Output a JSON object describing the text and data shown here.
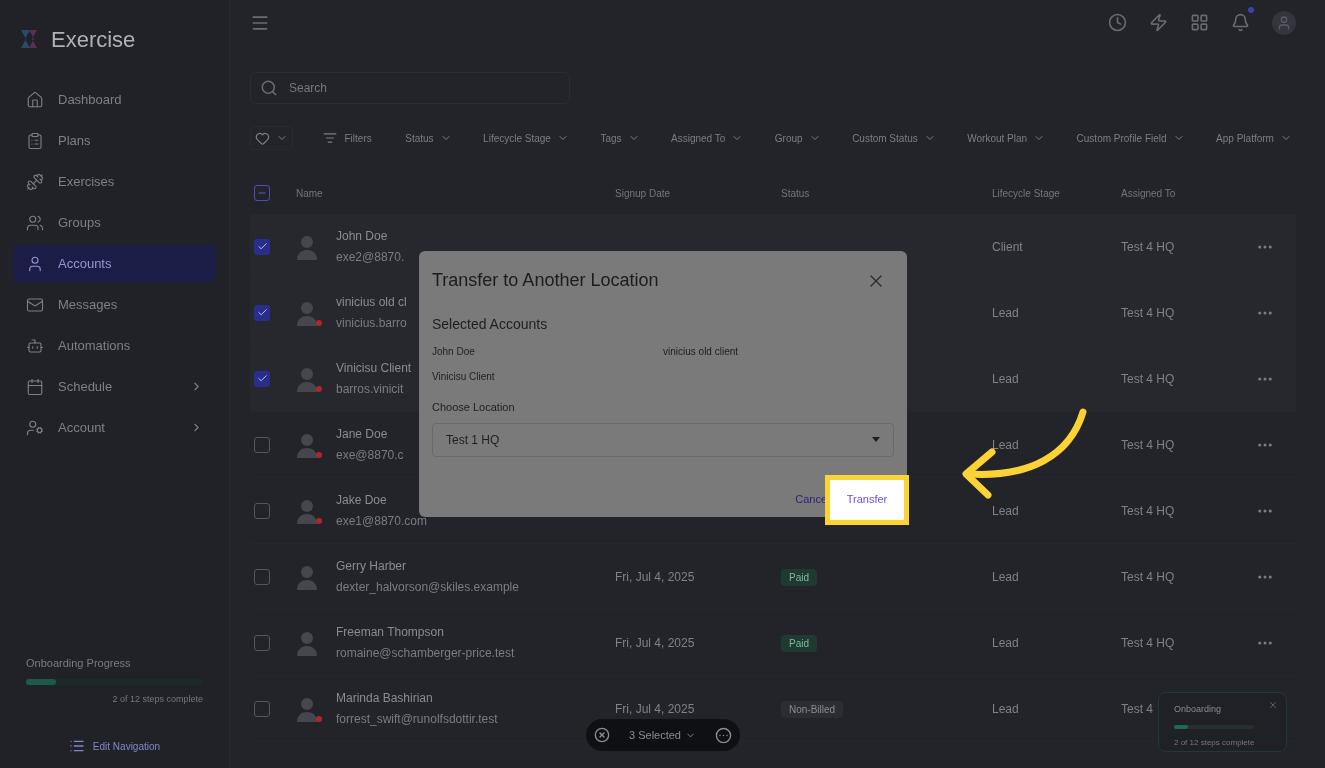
{
  "app": {
    "name": "Exercise"
  },
  "sidebar": {
    "items": [
      {
        "label": "Dashboard",
        "selected": false,
        "expandable": false
      },
      {
        "label": "Plans",
        "selected": false,
        "expandable": false
      },
      {
        "label": "Exercises",
        "selected": false,
        "expandable": false
      },
      {
        "label": "Groups",
        "selected": false,
        "expandable": false
      },
      {
        "label": "Accounts",
        "selected": true,
        "expandable": false
      },
      {
        "label": "Messages",
        "selected": false,
        "expandable": false
      },
      {
        "label": "Automations",
        "selected": false,
        "expandable": false
      },
      {
        "label": "Schedule",
        "selected": false,
        "expandable": true
      },
      {
        "label": "Account",
        "selected": false,
        "expandable": true
      }
    ],
    "onboarding": {
      "title": "Onboarding Progress",
      "level": 0.17,
      "caption": "2 of 12 steps complete"
    },
    "edit_navigation": "Edit Navigation"
  },
  "search": {
    "placeholder": "Search"
  },
  "filters": {
    "label": "Filters",
    "dropdowns": [
      "Status",
      "Lifecycle Stage",
      "Tags",
      "Assigned To",
      "Group",
      "Custom Status",
      "Workout Plan",
      "Custom Profile Field",
      "App Platform"
    ]
  },
  "table": {
    "select_all": {
      "indeterminate": true
    },
    "columns": [
      "Name",
      "Signup Date",
      "Status",
      "Lifecycle Stage",
      "Assigned To"
    ],
    "rows": [
      {
        "checked": true,
        "alert": false,
        "name": "John Doe",
        "email": "exe2@8870.",
        "lifecycle": "Client",
        "assigned": "Test 4 HQ",
        "menu": true
      },
      {
        "checked": true,
        "alert": true,
        "name": "vinicius old cl",
        "email": "vinicius.barro",
        "lifecycle": "Lead",
        "assigned": "Test 4 HQ",
        "menu": true
      },
      {
        "checked": true,
        "alert": true,
        "name": "Vinicisu Client",
        "email": "barros.vinicit",
        "lifecycle": "Lead",
        "assigned": "Test 4 HQ",
        "menu": true
      },
      {
        "checked": false,
        "alert": true,
        "name": "Jane Doe",
        "email": "exe@8870.c",
        "lifecycle": "Lead",
        "assigned": "Test 4 HQ",
        "menu": true
      },
      {
        "checked": false,
        "alert": true,
        "name": "Jake Doe",
        "email": "exe1@8870.com",
        "lifecycle": "Lead",
        "assigned": "Test 4 HQ",
        "menu": true
      },
      {
        "checked": false,
        "alert": false,
        "name": "Gerry Harber",
        "email": "dexter_halvorson@skiles.example",
        "date": "Fri, Jul 4, 2025",
        "status": {
          "label": "Paid",
          "kind": "paid"
        },
        "lifecycle": "Lead",
        "assigned": "Test 4 HQ",
        "menu": true
      },
      {
        "checked": false,
        "alert": false,
        "name": "Freeman Thompson",
        "email": "romaine@schamberger-price.test",
        "date": "Fri, Jul 4, 2025",
        "status": {
          "label": "Paid",
          "kind": "paid"
        },
        "lifecycle": "Lead",
        "assigned": "Test 4 HQ",
        "menu": true
      },
      {
        "checked": false,
        "alert": true,
        "name": "Marinda Bashirian",
        "email": "forrest_swift@runolfsdottir.test",
        "date": "Fri, Jul 4, 2025",
        "status": {
          "label": "Non-Billed",
          "kind": "plain"
        },
        "lifecycle": "Lead",
        "assigned": "Test 4",
        "menu": false
      }
    ]
  },
  "selection_bar": {
    "label": "3 Selected"
  },
  "onboarding_widget": {
    "title": "Onboarding",
    "level": 0.17,
    "caption": "2 of 12 steps complete"
  },
  "dialog": {
    "title": "Transfer to Another Location",
    "section": "Selected Accounts",
    "accounts": [
      "John Doe",
      "vinicius old client",
      "Vinicisu Client"
    ],
    "location_label": "Choose Location",
    "location_value": "Test 1 HQ",
    "cancel": "Cance",
    "confirm": "Transfer"
  }
}
